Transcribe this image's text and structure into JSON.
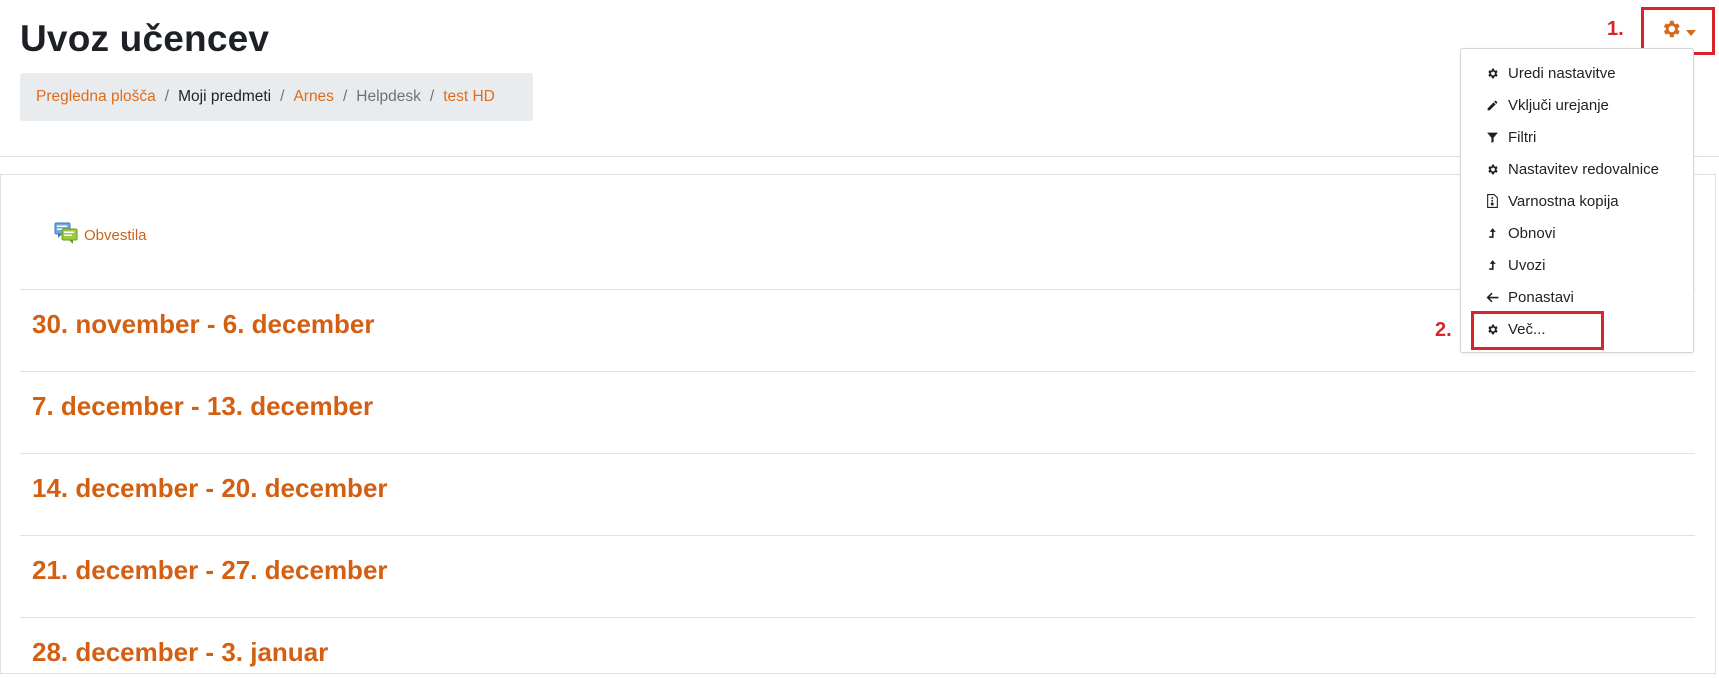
{
  "page": {
    "title": "Uvoz učencev"
  },
  "breadcrumb": [
    {
      "label": "Pregledna plošča",
      "style": "link"
    },
    {
      "label": "Moji predmeti",
      "style": "plain"
    },
    {
      "label": "Arnes",
      "style": "link"
    },
    {
      "label": "Helpdesk",
      "style": "muted"
    },
    {
      "label": "test HD",
      "style": "link"
    }
  ],
  "activity": {
    "label": "Obvestila",
    "icon": "forum-icon"
  },
  "sections": [
    {
      "title": "30. november - 6. december"
    },
    {
      "title": "7. december - 13. december"
    },
    {
      "title": "14. december - 20. december"
    },
    {
      "title": "21. december - 27. december"
    },
    {
      "title": "28. december - 3. januar"
    }
  ],
  "annotations": {
    "step1": "1.",
    "step2": "2."
  },
  "settings_menu": {
    "trigger_icon": "gear-icon",
    "items": [
      {
        "label": "Uredi nastavitve",
        "icon": "gear-icon"
      },
      {
        "label": "Vključi urejanje",
        "icon": "pencil-icon"
      },
      {
        "label": "Filtri",
        "icon": "filter-icon"
      },
      {
        "label": "Nastavitev redovalnice",
        "icon": "gear-icon"
      },
      {
        "label": "Varnostna kopija",
        "icon": "file-archive-icon"
      },
      {
        "label": "Obnovi",
        "icon": "level-up-icon"
      },
      {
        "label": "Uvozi",
        "icon": "level-up-icon"
      },
      {
        "label": "Ponastavi",
        "icon": "arrow-left-icon"
      },
      {
        "label": "Več...",
        "icon": "gear-icon"
      }
    ]
  },
  "colors": {
    "accent": "#d35f12",
    "annotation": "#d9242b",
    "breadcrumb_bg": "#e9ecef"
  }
}
